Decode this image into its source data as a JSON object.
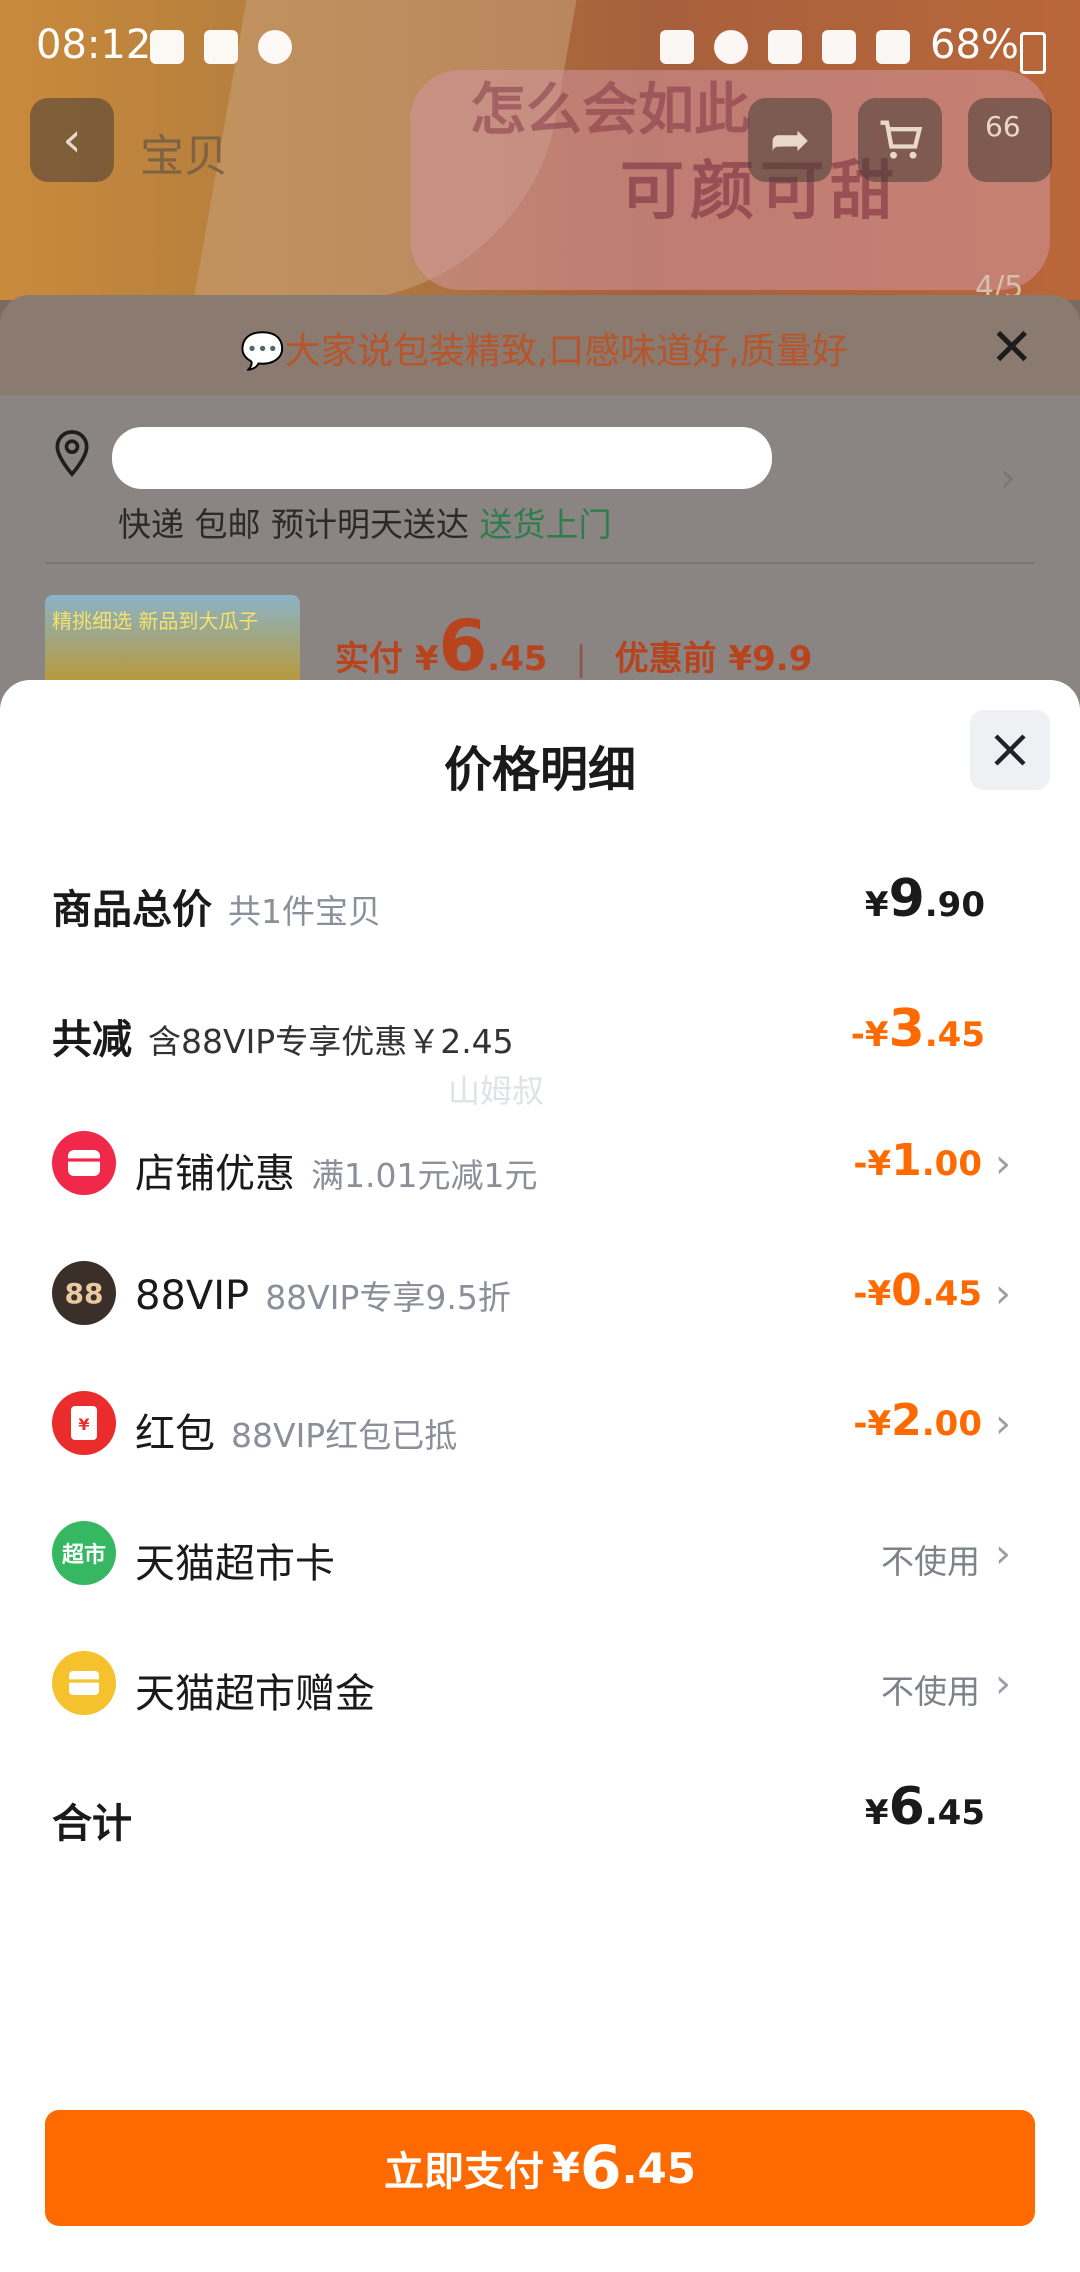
{
  "status_bar": {
    "time": "08:12",
    "battery": "68%"
  },
  "background": {
    "tab_title": "宝贝",
    "cart_count": "66",
    "page_indicator": "4/5",
    "banner_text": "可颜可甜",
    "banner_text2": "怎么会如此"
  },
  "mid_sheet": {
    "tip": "大家说包装精致,口感味道好,质量好",
    "shipping_prefix": "快递 包邮 预计明天送达",
    "shipping_green": "送货上门",
    "thumb_text": "精挑细选 新品到大瓜子",
    "pay_label": "实付",
    "currency": "¥",
    "pay_int": "6",
    "pay_dec": ".45",
    "before_label": "优惠前",
    "before_price": "¥9.9"
  },
  "price_detail": {
    "title": "价格明细",
    "total": {
      "label": "商品总价",
      "sub": "共1件宝贝",
      "currency": "¥",
      "int": "9",
      "dec": ".90"
    },
    "reduce": {
      "label": "共减",
      "sub": "含88VIP专享优惠￥2.45",
      "prefix": "-¥",
      "int": "3",
      "dec": ".45"
    },
    "watermark": "山姆叔",
    "items": [
      {
        "icon": "store-discount-icon",
        "icon_text": "",
        "color": "#f0284a",
        "label": "店铺优惠",
        "sub": "满1.01元减1元",
        "prefix": "-¥",
        "int": "1",
        "dec": ".00"
      },
      {
        "icon": "88vip-icon",
        "icon_text": "88",
        "color": "#3b2f2a",
        "label": "88VIP",
        "sub": "88VIP专享9.5折",
        "prefix": "-¥",
        "int": "0",
        "dec": ".45"
      },
      {
        "icon": "red-packet-icon",
        "icon_text": "¥",
        "color": "#ea2c2c",
        "label": "红包",
        "sub": "88VIP红包已抵",
        "prefix": "-¥",
        "int": "2",
        "dec": ".00"
      }
    ],
    "cards": [
      {
        "icon": "tmall-supermarket-card-icon",
        "icon_text": "超市",
        "color": "#36b862",
        "label": "天猫超市卡",
        "status": "不使用"
      },
      {
        "icon": "tmall-gift-money-icon",
        "icon_text": "",
        "color": "#f5c12c",
        "label": "天猫超市赠金",
        "status": "不使用"
      }
    ],
    "sum": {
      "label": "合计",
      "currency": "¥",
      "int": "6",
      "dec": ".45"
    },
    "pay_button": {
      "label": "立即支付",
      "currency": "¥",
      "int": "6",
      "dec": ".45"
    }
  },
  "colors": {
    "accent": "#ff6a00",
    "green": "#2e7d4c"
  }
}
